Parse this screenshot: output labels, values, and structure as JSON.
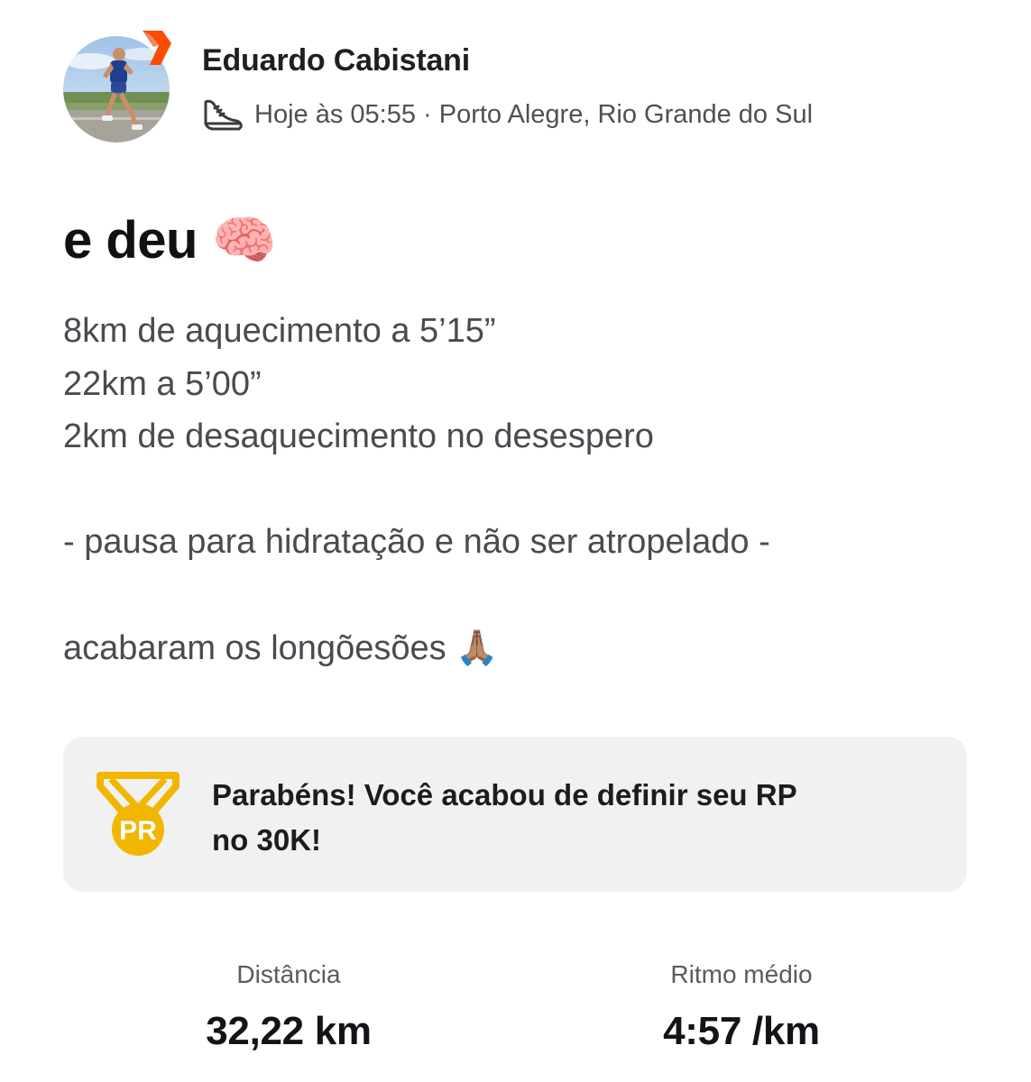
{
  "post": {
    "athlete_name": "Eduardo Cabistani",
    "meta": "Hoje às 05:55 · Porto Alegre, Rio Grande do Sul",
    "activity_icon": "running-shoe-icon",
    "title": "e deu",
    "title_emoji": "🧠",
    "description_lines": [
      "8km de aquecimento a 5’15”",
      "22km a 5’00”",
      "2km de desaquecimento no desespero",
      "",
      "- pausa para hidratação e não ser atropelado -",
      "",
      "acabaram os longõesões"
    ],
    "description_end_emoji": "🙏🏽"
  },
  "achievement": {
    "icon": "pr-medal-icon",
    "badge_text": "PR",
    "message_line1": "Parabéns! Você acabou de definir seu RP",
    "message_line2": "no 30K!"
  },
  "stats": {
    "distance": {
      "label": "Distância",
      "value": "32,22 km"
    },
    "pace": {
      "label": "Ritmo médio",
      "value": "4:57 /km"
    }
  },
  "colors": {
    "brand_orange": "#FC4C02",
    "medal_gold": "#F2B600",
    "card_background": "#F1F1F1"
  }
}
